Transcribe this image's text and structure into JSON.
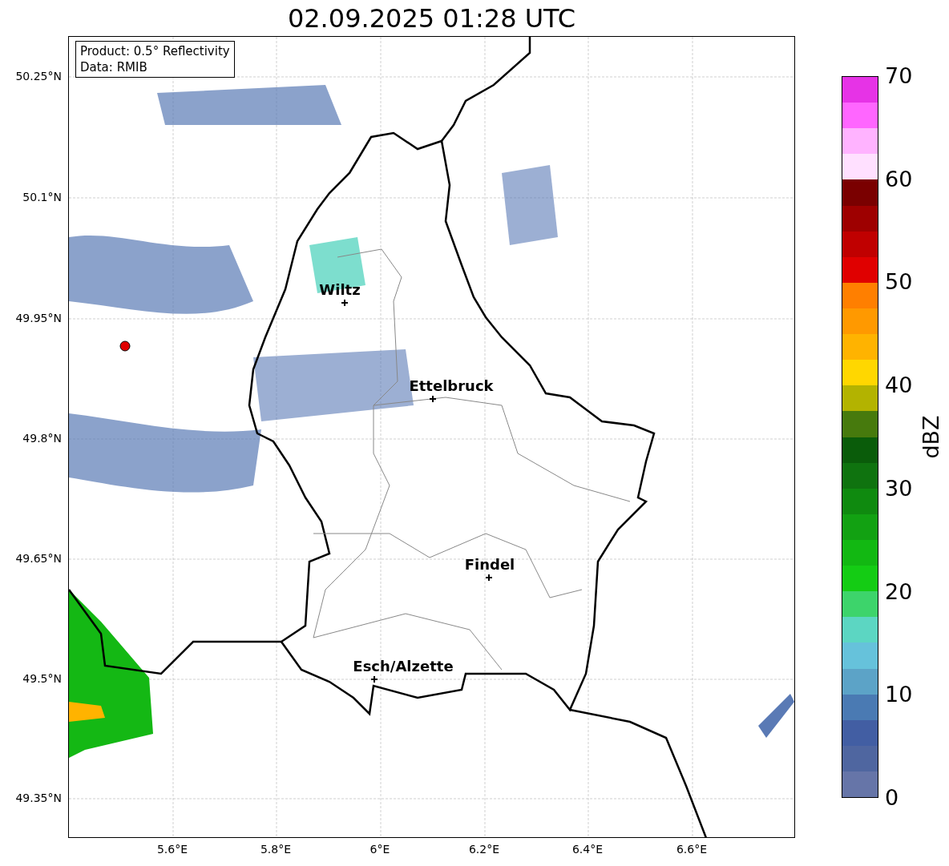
{
  "title": "02.09.2025 01:28 UTC",
  "info_box": {
    "lines": [
      "Product: 0.5° Reflectivity",
      "Data: RMIB"
    ]
  },
  "cities": [
    {
      "name": "Wiltz"
    },
    {
      "name": "Ettelbruck"
    },
    {
      "name": "Findel"
    },
    {
      "name": "Esch/Alzette"
    }
  ],
  "y_ticks": [
    "50.25°N",
    "50.1°N",
    "49.95°N",
    "49.8°N",
    "49.65°N",
    "49.5°N",
    "49.35°N"
  ],
  "x_ticks": [
    "5.6°E",
    "5.8°E",
    "6°E",
    "6.2°E",
    "6.4°E",
    "6.6°E"
  ],
  "colorbar": {
    "label": "dBZ",
    "ticks": [
      "70",
      "60",
      "50",
      "40",
      "30",
      "20",
      "10",
      "0"
    ],
    "segments": [
      {
        "color": "#e633e6"
      },
      {
        "color": "#ff66ff"
      },
      {
        "color": "#ffb3ff"
      },
      {
        "color": "#ffe0ff"
      },
      {
        "color": "#7a0000"
      },
      {
        "color": "#9e0000"
      },
      {
        "color": "#c00000"
      },
      {
        "color": "#e00000"
      },
      {
        "color": "#ff7f00"
      },
      {
        "color": "#ff9900"
      },
      {
        "color": "#ffb300"
      },
      {
        "color": "#ffd700"
      },
      {
        "color": "#b3b300"
      },
      {
        "color": "#477a0d"
      },
      {
        "color": "#0a5c0a"
      },
      {
        "color": "#0f730f"
      },
      {
        "color": "#0f8a0f"
      },
      {
        "color": "#12a112"
      },
      {
        "color": "#12b812"
      },
      {
        "color": "#14cc14"
      },
      {
        "color": "#3dd46b"
      },
      {
        "color": "#5cd6c2"
      },
      {
        "color": "#66c2db"
      },
      {
        "color": "#5ca3c7"
      },
      {
        "color": "#4a7ab3"
      },
      {
        "color": "#425ea3"
      },
      {
        "color": "#4f66a0"
      },
      {
        "color": "#6675a8"
      }
    ]
  }
}
